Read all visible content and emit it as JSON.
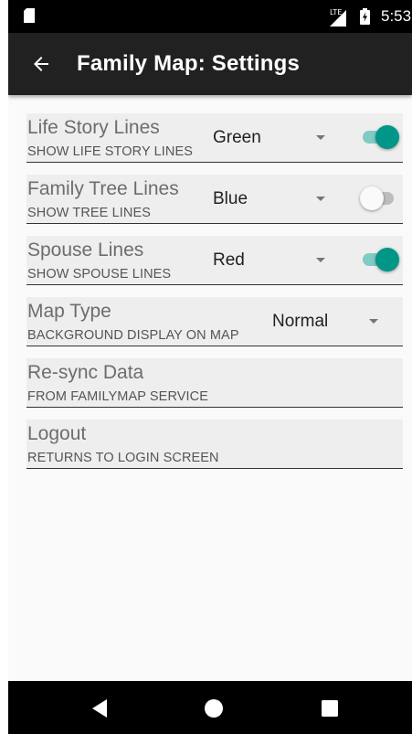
{
  "status_bar": {
    "network": "LTE",
    "time": "5:53",
    "icons": [
      "sd-card-icon",
      "signal-icon",
      "battery-charging-icon"
    ]
  },
  "app_bar": {
    "title": "Family Map: Settings",
    "back_icon": "arrow-back-icon"
  },
  "settings": {
    "life_story": {
      "title": "Life Story Lines",
      "subtitle": "SHOW LIFE STORY LINES",
      "color": "Green",
      "enabled": true
    },
    "family_tree": {
      "title": "Family Tree Lines",
      "subtitle": "SHOW TREE LINES",
      "color": "Blue",
      "enabled": false
    },
    "spouse": {
      "title": "Spouse Lines",
      "subtitle": "SHOW SPOUSE LINES",
      "color": "Red",
      "enabled": true
    },
    "map_type": {
      "title": "Map Type",
      "subtitle": "BACKGROUND DISPLAY ON MAP",
      "value": "Normal"
    },
    "resync": {
      "title": "Re-sync Data",
      "subtitle": "FROM FAMILYMAP SERVICE"
    },
    "logout": {
      "title": "Logout",
      "subtitle": "RETURNS TO LOGIN SCREEN"
    }
  },
  "nav_bar": {
    "icons": [
      "nav-back-icon",
      "nav-home-icon",
      "nav-recents-icon"
    ]
  },
  "colors": {
    "accent": "#009688",
    "accent_track": "#80cbc4",
    "app_bar": "#212121",
    "row_background": "#eeeeee"
  }
}
